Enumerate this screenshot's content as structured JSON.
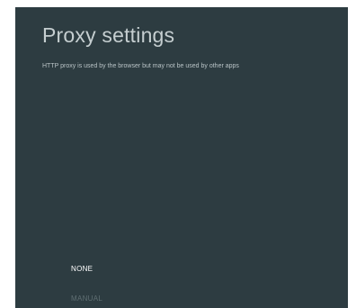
{
  "page": {
    "title": "Proxy settings",
    "subtitle": "HTTP proxy is used by the browser but may not be used by other apps"
  },
  "options": {
    "selected_value": "NONE",
    "items": [
      {
        "label": "NONE"
      },
      {
        "label": "MANUAL"
      }
    ]
  },
  "colors": {
    "background": "#2d3c41",
    "title": "#c5ced0",
    "selected_option": "#ffffff",
    "unselected_option": "#5f6e72"
  }
}
